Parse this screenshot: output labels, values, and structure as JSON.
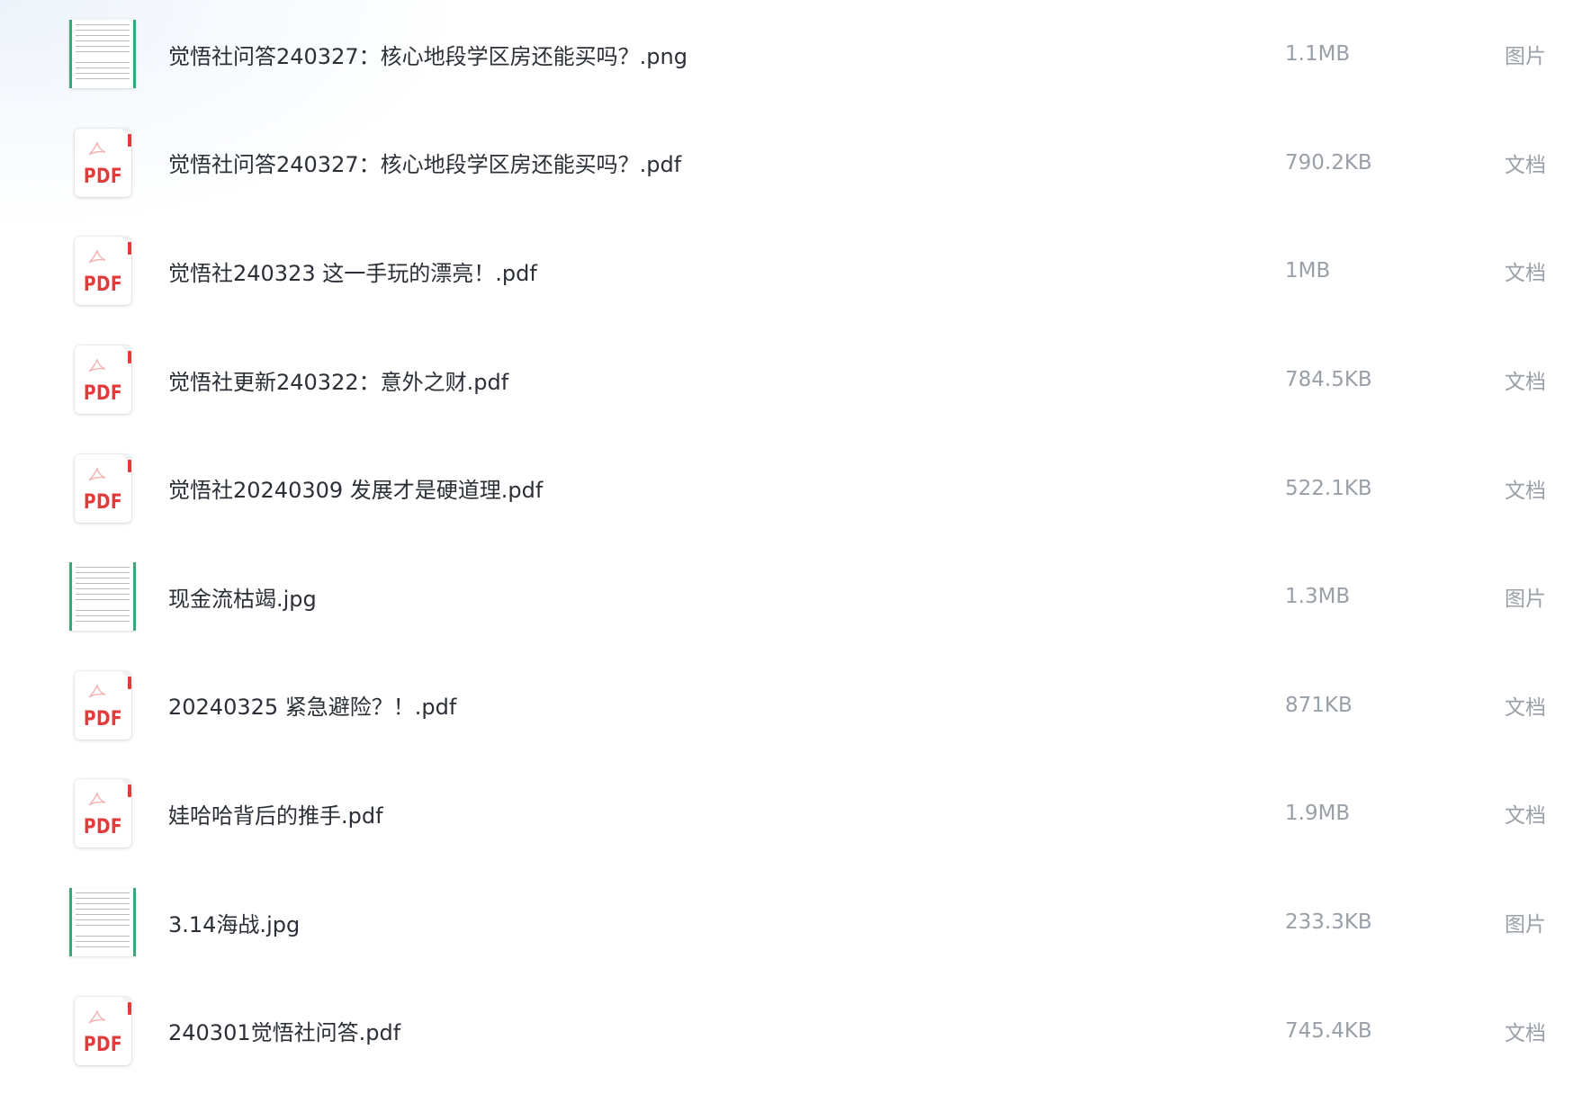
{
  "files": [
    {
      "name": "觉悟社问答240327：核心地段学区房还能买吗？.png",
      "size": "1.1MB",
      "type": "图片",
      "icon": "image-thumbnail-icon"
    },
    {
      "name": "觉悟社问答240327：核心地段学区房还能买吗？.pdf",
      "size": "790.2KB",
      "type": "文档",
      "icon": "pdf-file-icon",
      "icon_label": "PDF"
    },
    {
      "name": "觉悟社240323 这一手玩的漂亮！.pdf",
      "size": "1MB",
      "type": "文档",
      "icon": "pdf-file-icon",
      "icon_label": "PDF"
    },
    {
      "name": "觉悟社更新240322：意外之财.pdf",
      "size": "784.5KB",
      "type": "文档",
      "icon": "pdf-file-icon",
      "icon_label": "PDF"
    },
    {
      "name": "觉悟社20240309 发展才是硬道理.pdf",
      "size": "522.1KB",
      "type": "文档",
      "icon": "pdf-file-icon",
      "icon_label": "PDF"
    },
    {
      "name": "现金流枯竭.jpg",
      "size": "1.3MB",
      "type": "图片",
      "icon": "image-thumbnail-icon"
    },
    {
      "name": "20240325 紧急避险？！.pdf",
      "size": "871KB",
      "type": "文档",
      "icon": "pdf-file-icon",
      "icon_label": "PDF"
    },
    {
      "name": "娃哈哈背后的推手.pdf",
      "size": "1.9MB",
      "type": "文档",
      "icon": "pdf-file-icon",
      "icon_label": "PDF"
    },
    {
      "name": "3.14海战.jpg",
      "size": "233.3KB",
      "type": "图片",
      "icon": "image-thumbnail-icon"
    },
    {
      "name": "240301觉悟社问答.pdf",
      "size": "745.4KB",
      "type": "文档",
      "icon": "pdf-file-icon",
      "icon_label": "PDF"
    }
  ],
  "colors": {
    "pdf_red": "#e23b3b",
    "image_border_green": "#3aa67a",
    "name_text": "#2b2f36",
    "meta_text": "#9aa0a8"
  }
}
